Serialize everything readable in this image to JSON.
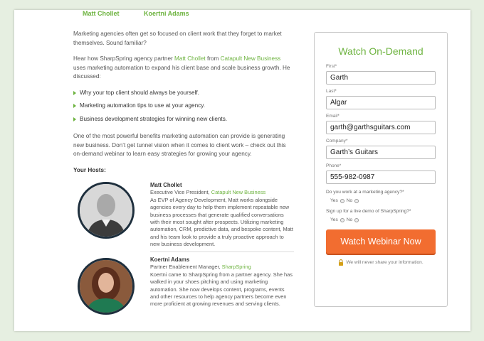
{
  "top_names": [
    "Matt Chollet",
    "Koertni Adams"
  ],
  "intro": {
    "p1": "Marketing agencies often get so focused on client work that they forget to market themselves. Sound familiar?",
    "p2_pre": "Hear how SharpSpring agency partner ",
    "p2_link1": "Matt Chollet",
    "p2_mid": " from ",
    "p2_link2": "Catapult New Business",
    "p2_post": " uses marketing automation to expand his client base and scale business growth. He discussed:"
  },
  "bullets": [
    "Why your top client should always be yourself.",
    "Marketing automation tips to use at your agency.",
    "Business development strategies for winning new clients."
  ],
  "p3": "One of the most powerful benefits marketing automation can provide is generating new business. Don’t get tunnel vision when it comes to client work – check out this on-demand webinar to learn easy strategies for growing your agency.",
  "hosts_heading": "Your Hosts:",
  "hosts": [
    {
      "name": "Matt Chollet",
      "title_pre": "Executive Vice President, ",
      "title_link": "Catapult New Business",
      "bio": "As EVP of Agency Development, Matt works alongside agencies every day to help them implement repeatable new business processes that generate qualified conversations with their most sought after prospects. Utilizing marketing automation, CRM, predictive data, and bespoke content, Matt and his team look to provide a truly proactive approach to new business development."
    },
    {
      "name": "Koertni Adams",
      "title_pre": "Partner Enablement Manager, ",
      "title_link": "SharpSpring",
      "bio": "Koertni came to SharpSpring from a partner agency. She has walked in your shoes pitching and using marketing automation. She now develops content, programs, events and other resources to help agency partners become even more proficient at growing revenues and serving clients."
    }
  ],
  "form": {
    "title": "Watch On-Demand",
    "fields": [
      {
        "label": "First*",
        "value": "Garth"
      },
      {
        "label": "Last*",
        "value": "Algar"
      },
      {
        "label": "Email*",
        "value": "garth@garthsguitars.com"
      },
      {
        "label": "Company*",
        "value": "Garth’s Guitars"
      },
      {
        "label": "Phone*",
        "value": "555-982-0987"
      }
    ],
    "q1": "Do you work at a marketing agency?*",
    "q2": "Sign up for a live demo of SharpSpring?*",
    "yes": "Yes",
    "no": "No",
    "button": "Watch Webinar Now",
    "privacy": "We will never share your information."
  },
  "colors": {
    "accent_green": "#6db33f",
    "button_orange": "#f26d30"
  }
}
